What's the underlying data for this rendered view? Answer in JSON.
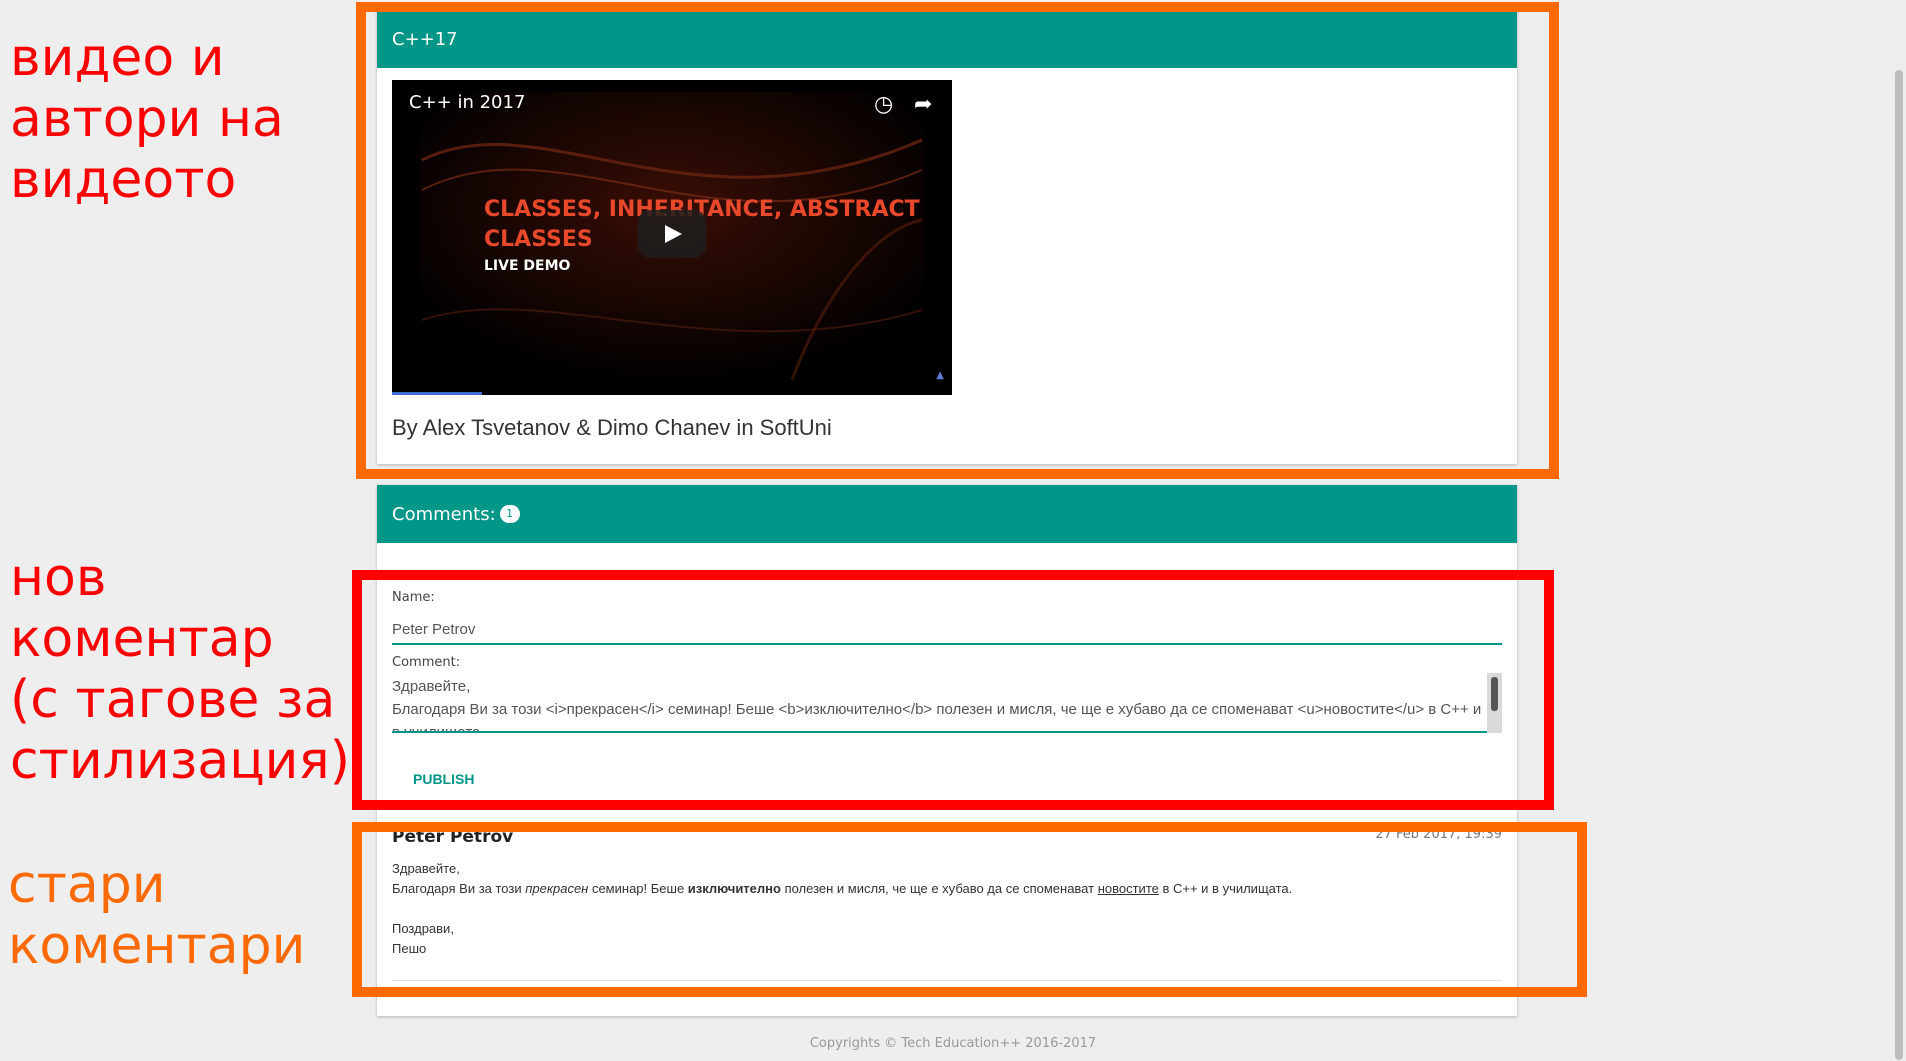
{
  "video_card": {
    "title": "C++17",
    "video": {
      "title": "C++ in 2017",
      "slide_heading_1": "CLASSES, INHERITANCE, ABSTRACT",
      "slide_heading_2": "CLASSES",
      "slide_sub": "LIVE DEMO",
      "icons": [
        "clock-icon",
        "share-icon",
        "play-icon"
      ]
    },
    "byline": "By Alex Tsvetanov & Dimo Chanev in SoftUni"
  },
  "comments_card": {
    "title": "Comments:",
    "count": "1",
    "form": {
      "name_label": "Name:",
      "name_value": "Peter Petrov",
      "comment_label": "Comment:",
      "comment_value": "Здравейте,\nБлагодаря Ви за този <i>прекрасен</i> семинар! Беше <b>изключително</b> полезен и мисля, че ще е хубаво да се споменават <u>новостите</u> в C++ и в училищата",
      "publish_label": "PUBLISH"
    },
    "old_comment": {
      "author": "Peter Petrov",
      "date": "27 Feb 2017, 19:39",
      "greeting": "Здравейте,",
      "line_part1": "Благодаря Ви за този ",
      "line_italic": "прекрасен",
      "line_part2": " семинар! Беше ",
      "line_bold": "изключително",
      "line_part3": " полезен и мисля, че ще е хубаво да се споменават ",
      "line_underline": "новостите",
      "line_part4": " в C++ и в училищата.",
      "sign_1": "Поздрави,",
      "sign_2": "Пешо"
    }
  },
  "footer": "Copyrights © Tech Education++ 2016-2017",
  "annotations": {
    "video": "видео и\nавтори на\nвидеото",
    "new_comment": "нов\nкоментар\n(с тагове за\nстилизация)",
    "old_comments": "стари\nкоментари"
  },
  "colors": {
    "accent": "#009688",
    "annotation_orange": "#ff6a00",
    "annotation_red": "#ff0000"
  }
}
